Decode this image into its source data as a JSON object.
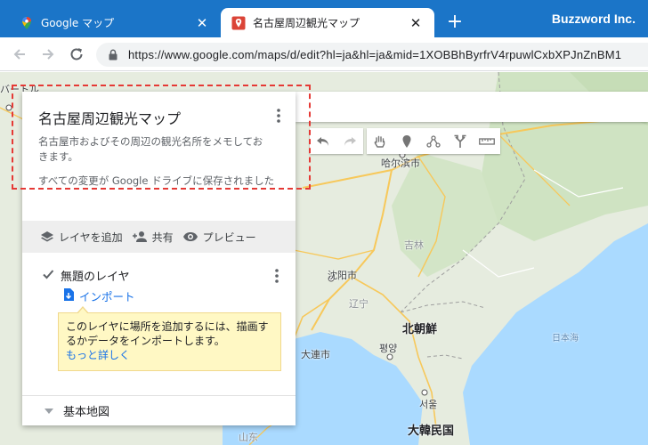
{
  "browser": {
    "tabs": [
      {
        "title": "Google マップ",
        "active": false,
        "favicon": "google-maps-icon"
      },
      {
        "title": "名古屋周辺観光マップ",
        "active": true,
        "favicon": "my-maps-pin-icon"
      }
    ],
    "new_tab": "+",
    "brand": "Buzzword Inc.",
    "url": "https://www.google.com/maps/d/edit?hl=ja&hl=ja&mid=1XOBBhByrfrV4rpuwlCxbXPJnZnBM1"
  },
  "panel": {
    "title": "名古屋周辺観光マップ",
    "description": "名古屋市およびその周辺の観光名所をメモしておきます。",
    "saved_status": "すべての変更が Google ドライブに保存されました",
    "actions": {
      "add_layer": "レイヤを追加",
      "share": "共有",
      "preview": "プレビュー"
    },
    "layer": {
      "name": "無題のレイヤ",
      "checked": true,
      "import_label": "インポート"
    },
    "tip": {
      "text": "このレイヤに場所を追加するには、描画するかデータをインポートします。",
      "more": "もっと詳しく"
    },
    "base_map": "基本地図"
  },
  "map": {
    "labels": {
      "harbin": "哈尔滨市",
      "jilin": "吉林",
      "shenyang": "沈阳市",
      "liaoning": "辽宁",
      "north_korea": "北朝鮮",
      "pyongyang": "평양",
      "dalian": "大連市",
      "seoul": "서울",
      "south_korea": "大韓民国",
      "sea_of_japan": "日本海",
      "shandong": "山东",
      "edge_label": "バートル"
    }
  },
  "colors": {
    "tab_bar": "#1b75c8",
    "link": "#1a73e8",
    "highlight": "#e53935",
    "tip_bg": "#fff8c4"
  }
}
